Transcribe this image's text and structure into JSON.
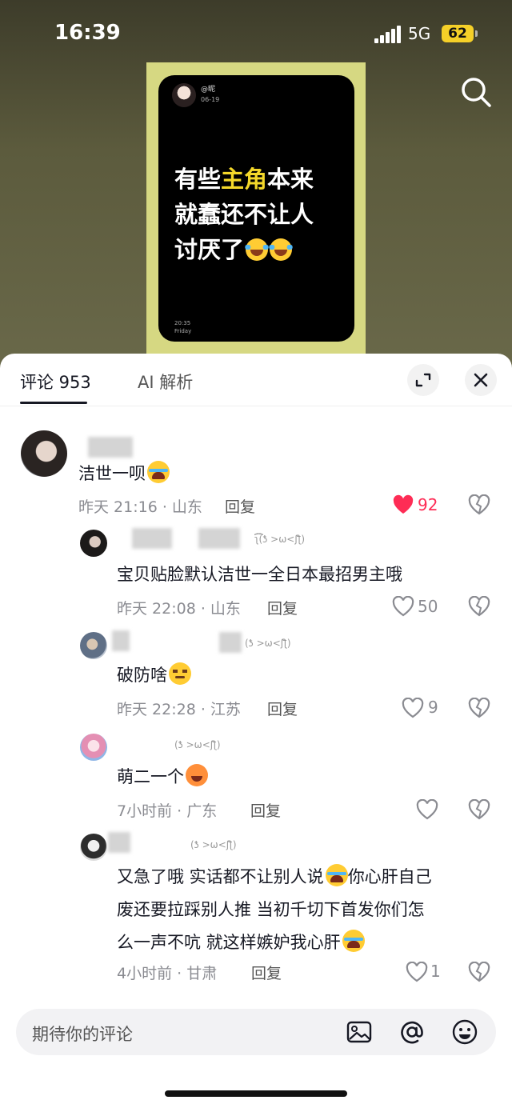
{
  "status_bar": {
    "time": "16:39",
    "network": "5G",
    "battery": "62"
  },
  "poster": {
    "user": "@昵",
    "date": "06-19",
    "line1_a": "有些",
    "line1_hl": "主角",
    "line1_b": "本来",
    "line2": "就蠢还不让人",
    "line3": "讨厌了",
    "foot_time": "20:35",
    "foot_day": "Friday"
  },
  "sheet": {
    "tab_comments": "评论 953",
    "tab_ai": "AI 解析",
    "input_placeholder": "期待你的评论"
  },
  "comments": [
    {
      "text": "洁世一呗",
      "meta": "昨天 21:16 · 山东",
      "reply": "回复",
      "likes": "92",
      "liked": true
    },
    {
      "name_meta": "ʅ͡͡͡͡͡͡͡͡͡͡͡(ƾ >ω<ʃƪ)",
      "text": "宝贝贴脸默认洁世一全日本最招男主哦",
      "meta": "昨天 22:08 · 山东",
      "reply": "回复",
      "likes": "50"
    },
    {
      "name_meta": "(ƾ >ω<ʃƪ)",
      "text": "破防啥",
      "meta": "昨天 22:28 · 江苏",
      "reply": "回复",
      "likes": "9"
    },
    {
      "name_meta": "(ƾ >ω<ʃƪ)",
      "text": "萌二一个",
      "meta": "7小时前 · 广东",
      "reply": "回复",
      "likes": ""
    },
    {
      "name_meta": "(ƾ >ω<ʃƪ)",
      "text_l1": "又急了哦 实话都不让别人说",
      "text_l1b": "你心肝自己",
      "text_l2": "废还要拉踩别人推 当初千切下首发你们怎",
      "text_l3": "么一声不吭 就这样嫉妒我心肝",
      "meta": "4小时前 · 甘肃",
      "reply": "回复",
      "likes": "1"
    }
  ],
  "icons": {
    "search": "search-icon",
    "expand": "expand-icon",
    "close": "close-icon",
    "heart": "heart-icon",
    "dislike": "broken-heart-icon",
    "image": "image-icon",
    "mention": "at-icon",
    "emoji": "emoji-icon"
  },
  "colors": {
    "accent": "#fe2c55",
    "poster_bg": "#d6d882",
    "highlight": "#f4d82a",
    "battery": "#f5d028"
  }
}
